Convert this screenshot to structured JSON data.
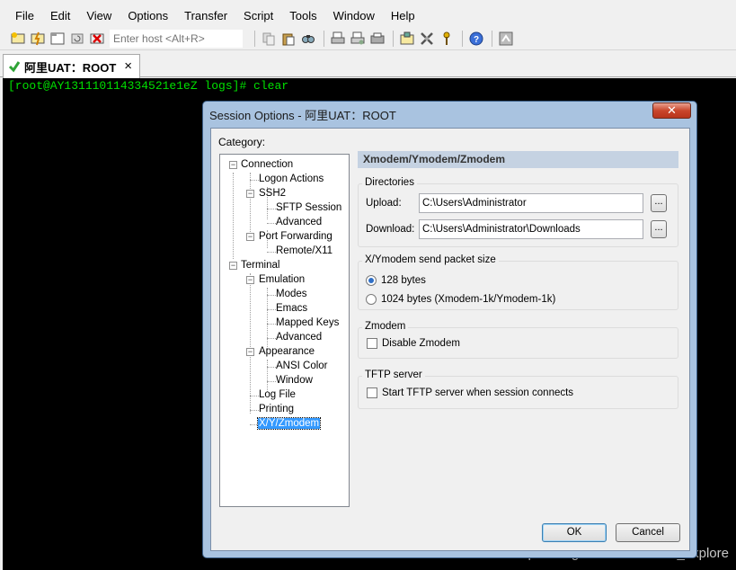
{
  "menu": [
    "File",
    "Edit",
    "View",
    "Options",
    "Transfer",
    "Script",
    "Tools",
    "Window",
    "Help"
  ],
  "toolbar": {
    "quick_connect_placeholder": "Enter host <Alt+R>",
    "icons": [
      "connect-icon",
      "quick-connect-icon",
      "connect-in-tab-icon",
      "reconnect-icon",
      "disconnect-icon",
      "copy-icon",
      "paste-icon",
      "find-icon",
      "print-icon",
      "print-setup-icon",
      "print-screen-icon",
      "session-options-icon",
      "global-options-icon",
      "keymap-icon",
      "help-icon",
      "sftp-icon"
    ]
  },
  "tab": {
    "label": "阿里UAT：ROOT",
    "close": "×"
  },
  "terminal": {
    "line1": "[root@AY131110114334521e1eZ logs]# clear"
  },
  "watermark": "https://blog.csdn.net/delunz_explore",
  "dialog": {
    "title": "Session Options - 阿里UAT：ROOT",
    "close": "✕",
    "category_label": "Category:",
    "tree": [
      {
        "label": "Connection"
      },
      {
        "label": "Logon Actions"
      },
      {
        "label": "SSH2"
      },
      {
        "label": "SFTP Session"
      },
      {
        "label": "Advanced"
      },
      {
        "label": "Port Forwarding"
      },
      {
        "label": "Remote/X11"
      },
      {
        "label": "Terminal"
      },
      {
        "label": "Emulation"
      },
      {
        "label": "Modes"
      },
      {
        "label": "Emacs"
      },
      {
        "label": "Mapped Keys"
      },
      {
        "label": "Advanced"
      },
      {
        "label": "Appearance"
      },
      {
        "label": "ANSI Color"
      },
      {
        "label": "Window"
      },
      {
        "label": "Log File"
      },
      {
        "label": "Printing"
      },
      {
        "label": "X/Y/Zmodem"
      }
    ],
    "panel_title": "Xmodem/Ymodem/Zmodem",
    "directories": {
      "title": "Directories",
      "upload_label": "Upload:",
      "upload_value": "C:\\Users\\Administrator",
      "download_label": "Download:",
      "download_value": "C:\\Users\\Administrator\\Downloads",
      "browse": "..."
    },
    "packet": {
      "title": "X/Ymodem send packet size",
      "opt1": "128 bytes",
      "opt2": "1024 bytes  (Xmodem-1k/Ymodem-1k)",
      "selected": "128 bytes"
    },
    "zmodem": {
      "title": "Zmodem",
      "disable": "Disable Zmodem"
    },
    "tftp": {
      "title": "TFTP server",
      "start": "Start TFTP server when session connects"
    },
    "ok": "OK",
    "cancel": "Cancel"
  }
}
